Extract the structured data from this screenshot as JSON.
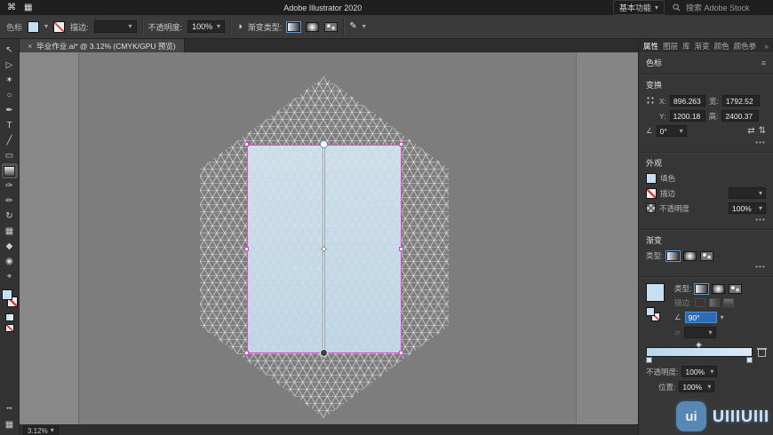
{
  "icons": {
    "apple": "⌘",
    "app_grid": "▦",
    "chevron_down": "▾",
    "close": "×",
    "more_h": "•••",
    "panel_menu": "≡",
    "overflow": "»",
    "flip_h": "⇄",
    "flip_v": "⇅",
    "angle": "∠",
    "half_circle": "◑",
    "pen_edit": "✎",
    "ratio": "▱"
  },
  "menubar": {
    "title": "Adobe Illustrator 2020",
    "workspace": "基本功能",
    "search_placeholder": "搜索 Adobe Stock"
  },
  "control_bar": {
    "swatch_label": "色标",
    "stroke_label": "描边:",
    "opacity_label": "不透明度:",
    "opacity_value": "100%",
    "gradient_type_label": "渐变类型:"
  },
  "document": {
    "tab_title": "毕业作业.ai* @ 3.12% (CMYK/GPU 预览)",
    "zoom": "3.12%"
  },
  "toolbar": {
    "tools": [
      {
        "name": "selection-tool",
        "glyph": "↖"
      },
      {
        "name": "direct-selection-tool",
        "glyph": "▷"
      },
      {
        "name": "magic-wand-tool",
        "glyph": "✶"
      },
      {
        "name": "lasso-tool",
        "glyph": "○"
      },
      {
        "name": "pen-tool",
        "glyph": "✒"
      },
      {
        "name": "type-tool",
        "glyph": "T"
      },
      {
        "name": "line-segment-tool",
        "glyph": "╱"
      },
      {
        "name": "rectangle-tool",
        "glyph": "▭"
      },
      {
        "name": "gradient-tool",
        "glyph": ""
      },
      {
        "name": "paintbrush-tool",
        "glyph": "✑"
      },
      {
        "name": "pencil-tool",
        "glyph": "✏"
      },
      {
        "name": "rotate-tool",
        "glyph": "↻"
      },
      {
        "name": "mesh-tool",
        "glyph": "▦"
      },
      {
        "name": "eyedropper-tool",
        "glyph": "◆"
      },
      {
        "name": "blend-tool",
        "glyph": "◉"
      },
      {
        "name": "zoom-tool",
        "glyph": "⌖"
      }
    ]
  },
  "panel": {
    "tabs": [
      "属性",
      "图层",
      "库",
      "渐变",
      "颜色",
      "颜色参"
    ],
    "selection_type": "色标",
    "transform": {
      "title": "变换",
      "x_label": "X:",
      "x_value": "896.263",
      "y_label": "Y:",
      "y_value": "1200.18",
      "w_label": "宽:",
      "w_value": "1792.52",
      "h_label": "高:",
      "h_value": "2400.37",
      "angle_value": "0°"
    },
    "appearance": {
      "title": "外观",
      "fill_label": "填色",
      "stroke_label": "描边",
      "opacity_label": "不透明度",
      "opacity_value": "100%"
    },
    "gradient_section": {
      "title": "渐变",
      "type_label": "类型:"
    },
    "gradient_panel": {
      "type_label": "类型:",
      "stroke_label": "描边:",
      "angle_value": "90°",
      "opacity_label": "不透明度:",
      "opacity_value": "100%",
      "position_label": "位置:",
      "position_value": "100%"
    }
  },
  "watermark": {
    "brand": "UIIIUIII",
    "badge": "ui"
  }
}
